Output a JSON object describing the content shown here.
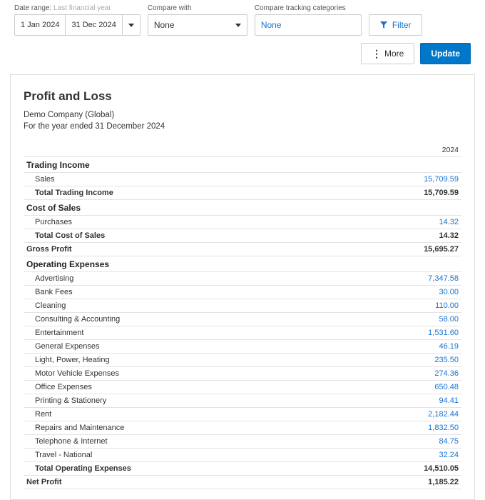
{
  "toolbar": {
    "date_range_label": "Date range:",
    "date_range_hint": "Last financial year",
    "date_from": "1 Jan 2024",
    "date_to": "31 Dec 2024",
    "compare_with_label": "Compare with",
    "compare_with_value": "None",
    "compare_tracking_label": "Compare tracking categories",
    "compare_tracking_value": "None",
    "filter_label": "Filter"
  },
  "actions": {
    "more_label": "More",
    "update_label": "Update"
  },
  "report": {
    "title": "Profit and Loss",
    "company": "Demo Company (Global)",
    "period": "For the year ended 31 December 2024",
    "year_col": "2024",
    "sections": [
      {
        "heading": "Trading Income",
        "lines": [
          {
            "name": "Sales",
            "value": "15,709.59",
            "link": true
          }
        ],
        "total": {
          "name": "Total Trading Income",
          "value": "15,709.59"
        }
      },
      {
        "heading": "Cost of Sales",
        "lines": [
          {
            "name": "Purchases",
            "value": "14.32",
            "link": true
          }
        ],
        "total": {
          "name": "Total Cost of Sales",
          "value": "14.32"
        }
      }
    ],
    "gross_profit": {
      "name": "Gross Profit",
      "value": "15,695.27"
    },
    "operating": {
      "heading": "Operating Expenses",
      "lines": [
        {
          "name": "Advertising",
          "value": "7,347.58",
          "link": true
        },
        {
          "name": "Bank Fees",
          "value": "30.00",
          "link": true
        },
        {
          "name": "Cleaning",
          "value": "110.00",
          "link": true
        },
        {
          "name": "Consulting & Accounting",
          "value": "58.00",
          "link": true
        },
        {
          "name": "Entertainment",
          "value": "1,531.60",
          "link": true
        },
        {
          "name": "General Expenses",
          "value": "46.19",
          "link": true
        },
        {
          "name": "Light, Power, Heating",
          "value": "235.50",
          "link": true
        },
        {
          "name": "Motor Vehicle Expenses",
          "value": "274.36",
          "link": true
        },
        {
          "name": "Office Expenses",
          "value": "650.48",
          "link": true
        },
        {
          "name": "Printing & Stationery",
          "value": "94.41",
          "link": true
        },
        {
          "name": "Rent",
          "value": "2,182.44",
          "link": true
        },
        {
          "name": "Repairs and Maintenance",
          "value": "1,832.50",
          "link": true
        },
        {
          "name": "Telephone & Internet",
          "value": "84.75",
          "link": true
        },
        {
          "name": "Travel - National",
          "value": "32.24",
          "link": true
        }
      ],
      "total": {
        "name": "Total Operating Expenses",
        "value": "14,510.05"
      }
    },
    "net_profit": {
      "name": "Net Profit",
      "value": "1,185.22"
    }
  }
}
